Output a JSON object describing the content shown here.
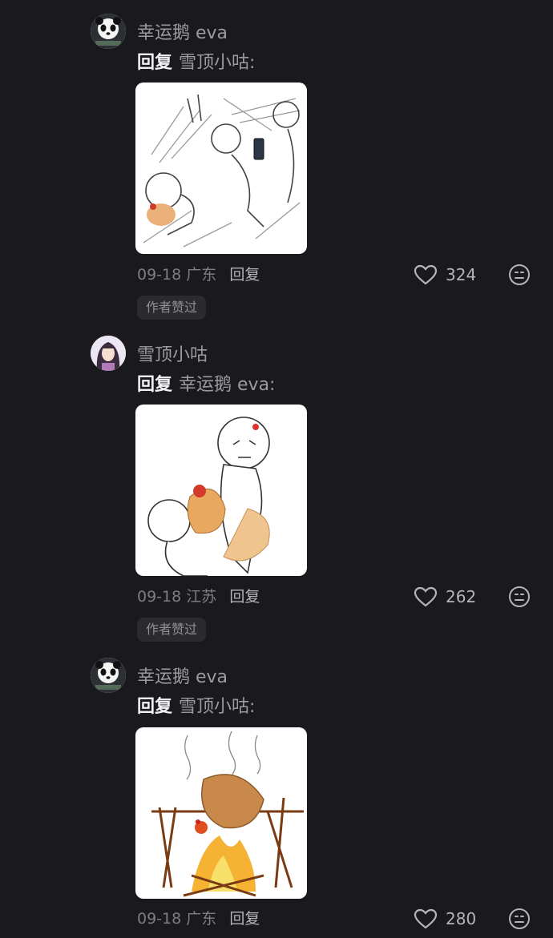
{
  "comments": [
    {
      "username": "幸运鹅 eva",
      "avatar_icon": "panda-avatar-icon",
      "reply_word": "回复",
      "reply_target": "雪顶小咕:",
      "image_icon": "sketch-people-fighting-chicken-icon",
      "date": "09-18",
      "location": "广东",
      "reply_button": "回复",
      "likes": "324",
      "badge": "作者赞过"
    },
    {
      "username": "雪顶小咕",
      "avatar_icon": "girl-avatar-icon",
      "reply_word": "回复",
      "reply_target": "幸运鹅 eva:",
      "image_icon": "sketch-angry-chicken-fight-icon",
      "date": "09-18",
      "location": "江苏",
      "reply_button": "回复",
      "likes": "262",
      "badge": "作者赞过"
    },
    {
      "username": "幸运鹅 eva",
      "avatar_icon": "panda-avatar-icon",
      "reply_word": "回复",
      "reply_target": "雪顶小咕:",
      "image_icon": "sketch-roast-chicken-fire-icon",
      "date": "09-18",
      "location": "广东",
      "reply_button": "回复",
      "likes": "280"
    }
  ],
  "colors": {
    "background": "#1a1a1e",
    "primary_text": "#f2f2f4",
    "secondary_text": "#9b9ba1",
    "badge_bg": "#2a2a2f"
  }
}
